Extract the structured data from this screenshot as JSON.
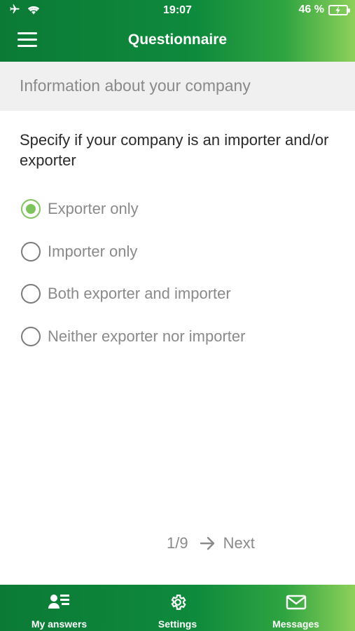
{
  "status_bar": {
    "time": "19:07",
    "battery_percent": "46 %",
    "icons": [
      "airplane-icon",
      "wifi-icon",
      "battery-charging-icon"
    ]
  },
  "header": {
    "title": "Questionnaire",
    "menu_icon": "hamburger-menu-icon"
  },
  "section": {
    "title": "Information about your company"
  },
  "question": {
    "text": "Specify if your company is an importer and/or exporter",
    "options": [
      {
        "label": "Exporter only",
        "selected": true
      },
      {
        "label": "Importer only",
        "selected": false
      },
      {
        "label": "Both exporter and importer",
        "selected": false
      },
      {
        "label": "Neither exporter nor importer",
        "selected": false
      }
    ]
  },
  "pager": {
    "progress": "1/9",
    "next_label": "Next"
  },
  "tabbar": {
    "tabs": [
      {
        "label": "My answers",
        "icon": "user-list-icon"
      },
      {
        "label": "Settings",
        "icon": "gear-icon"
      },
      {
        "label": "Messages",
        "icon": "envelope-icon"
      }
    ]
  },
  "colors": {
    "brand_green": "#0e8a3c",
    "accent_light_green": "#7fc35e"
  }
}
